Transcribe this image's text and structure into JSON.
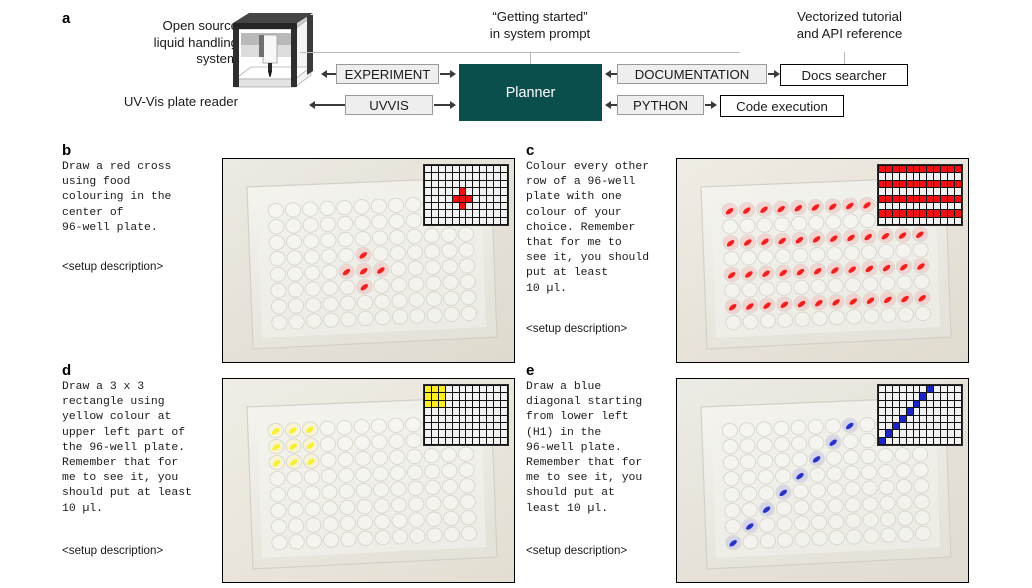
{
  "figure": {
    "panels": [
      "a",
      "b",
      "c",
      "d",
      "e"
    ]
  },
  "panel_a": {
    "letter": "a",
    "captions": {
      "liquid_handler": "Open source\nliquid handling\nsystem",
      "plate_reader": "UV-Vis plate reader",
      "system_prompt": "“Getting started”\nin system prompt",
      "documentation_source": "Vectorized tutorial\nand API reference"
    },
    "channels": {
      "experiment": "EXPERIMENT",
      "uvvis": "UVVIS",
      "documentation": "DOCUMENTATION",
      "python": "PYTHON"
    },
    "nodes": {
      "planner": "Planner",
      "docs_searcher": "Docs searcher",
      "code_execution": "Code execution"
    },
    "colors": {
      "planner_fill": "#0b4f4d",
      "planner_text": "#ffffff",
      "channel_fill": "#eeeeee",
      "channel_border": "#9a9a9a",
      "node_border": "#000000",
      "arrow": "#3a3a3a",
      "leader": "#b9b9b9"
    }
  },
  "panel_b": {
    "letter": "b",
    "prompt": "Draw a red cross\nusing food\ncolouring in the\ncenter of\n96-well plate.",
    "setup_label": "<setup description>",
    "inset": {
      "rows": 8,
      "cols": 12,
      "colour": "#f01010",
      "colour_name": "red",
      "filled_wells": [
        [
          3,
          5
        ],
        [
          4,
          4
        ],
        [
          4,
          5
        ],
        [
          4,
          6
        ],
        [
          5,
          5
        ]
      ]
    }
  },
  "panel_c": {
    "letter": "c",
    "prompt": "Colour every other\nrow of a 96-well\nplate with one\ncolour of your\nchoice. Remember\nthat for me to\nsee it, you should\nput at least\n10 µl.",
    "setup_label": "<setup description>",
    "inset": {
      "rows": 8,
      "cols": 12,
      "colour": "#f01010",
      "colour_name": "red",
      "filled_rows": [
        0,
        2,
        4,
        6
      ]
    }
  },
  "panel_d": {
    "letter": "d",
    "prompt": "Draw a 3 x 3\nrectangle using\nyellow colour at\nupper left part of\nthe 96-well plate.\nRemember that for\nme to see it, you\nshould put at least\n10 µl.",
    "setup_label": "<setup description>",
    "inset": {
      "rows": 8,
      "cols": 12,
      "colour": "#fcee22",
      "colour_name": "yellow",
      "filled_wells": [
        [
          0,
          0
        ],
        [
          0,
          1
        ],
        [
          0,
          2
        ],
        [
          1,
          0
        ],
        [
          1,
          1
        ],
        [
          1,
          2
        ],
        [
          2,
          0
        ],
        [
          2,
          1
        ],
        [
          2,
          2
        ]
      ]
    }
  },
  "panel_e": {
    "letter": "e",
    "prompt": "Draw a blue\ndiagonal starting\nfrom lower left\n(H1) in the\n96-well plate.\nRemember that for\nme to see it, you\nshould put at\nleast 10 µl.",
    "setup_label": "<setup description>",
    "inset": {
      "rows": 8,
      "cols": 12,
      "colour": "#1a25c8",
      "colour_name": "blue",
      "filled_wells": [
        [
          7,
          0
        ],
        [
          6,
          1
        ],
        [
          5,
          2
        ],
        [
          4,
          3
        ],
        [
          3,
          4
        ],
        [
          2,
          5
        ],
        [
          1,
          6
        ],
        [
          0,
          7
        ]
      ]
    }
  }
}
